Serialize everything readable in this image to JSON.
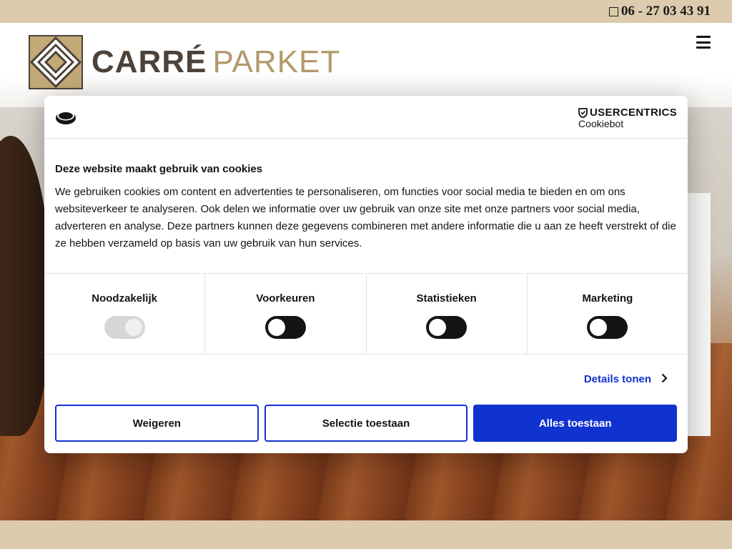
{
  "topbar": {
    "phone": "06 - 27 03 43 91"
  },
  "header": {
    "logo_word1": "CARRÉ",
    "logo_word2": "PARKET"
  },
  "cookie_dialog": {
    "brand_name": "USERCENTRICS",
    "brand_sub": "Cookiebot",
    "title": "Deze website maakt gebruik van cookies",
    "text": "We gebruiken cookies om content en advertenties te personaliseren, om functies voor social media te bieden en om ons websiteverkeer te analyseren. Ook delen we informatie over uw gebruik van onze site met onze partners voor social media, adverteren en analyse. Deze partners kunnen deze gegevens combineren met andere informatie die u aan ze heeft verstrekt of die ze hebben verzameld op basis van uw gebruik van hun services.",
    "toggles": [
      {
        "label": "Noodzakelijk",
        "state": "on-disabled"
      },
      {
        "label": "Voorkeuren",
        "state": "off"
      },
      {
        "label": "Statistieken",
        "state": "off"
      },
      {
        "label": "Marketing",
        "state": "off"
      }
    ],
    "details_label": "Details tonen",
    "buttons": {
      "decline": "Weigeren",
      "selection": "Selectie toestaan",
      "accept_all": "Alles toestaan"
    },
    "colors": {
      "accent": "#1032cf",
      "toggle_off": "#141414",
      "toggle_disabled": "#d6d6d6"
    }
  },
  "colors": {
    "band": "#dccbac",
    "logo_dark": "#4d4239",
    "logo_gold": "#b39a6a"
  }
}
